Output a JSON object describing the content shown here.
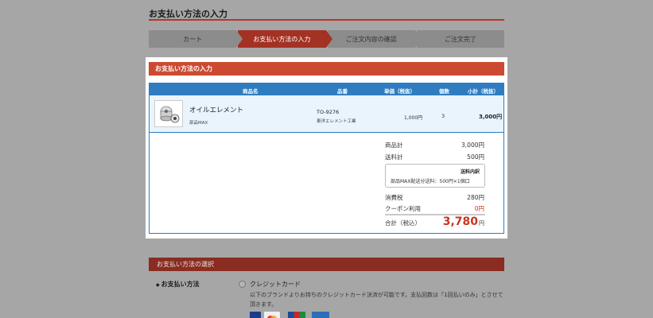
{
  "page": {
    "title": "お支払い方法の入力",
    "steps": [
      "カート",
      "お支払い方法の入力",
      "ご注文内容の確認",
      "ご注文完了"
    ]
  },
  "section": {
    "title": "お支払い方法の入力"
  },
  "cart_table": {
    "headers": {
      "name": "商品名",
      "code": "品番",
      "unit_price": "単価（税抜）",
      "qty": "個数",
      "subtotal": "小計（税抜）"
    },
    "item": {
      "name": "オイルエレメント",
      "brand": "部品MAX",
      "code": "TO-9276",
      "maker": "東洋エレメント工業",
      "unit_price": "1,000円",
      "qty": "3",
      "subtotal": "3,000円",
      "image_icon": "oil-filter-icon"
    }
  },
  "summary": {
    "goods_label": "商品計",
    "goods_value": "3,000円",
    "shipping_label": "送料計",
    "shipping_value": "500円",
    "shipping_box_title": "送料内訳",
    "shipping_box_detail": "部品MAX配送分送料：500円×1個口",
    "tax_label": "消費税",
    "tax_value": "280円",
    "coupon_label": "クーポン利用",
    "coupon_value": "0円",
    "total_label": "合計（税込）",
    "total_value": "3,780",
    "total_unit": "円"
  },
  "payment": {
    "section_title": "お支払い方法の選択",
    "label": "お支払い方法",
    "label_prefix": "◆",
    "option_credit": "クレジットカード",
    "credit_desc": "以下のブランドよりお持ちのクレジットカード決済が可能です。支払回数は「1回払いのみ」とさせて頂きます。",
    "card_icons": [
      "visa-icon",
      "mastercard-icon",
      "jcb-icon",
      "amex-icon"
    ]
  },
  "colors": {
    "accent": "#cc4a32",
    "step_active": "#a33224",
    "table_blue": "#2f7dc0",
    "total_red": "#c8341f"
  }
}
